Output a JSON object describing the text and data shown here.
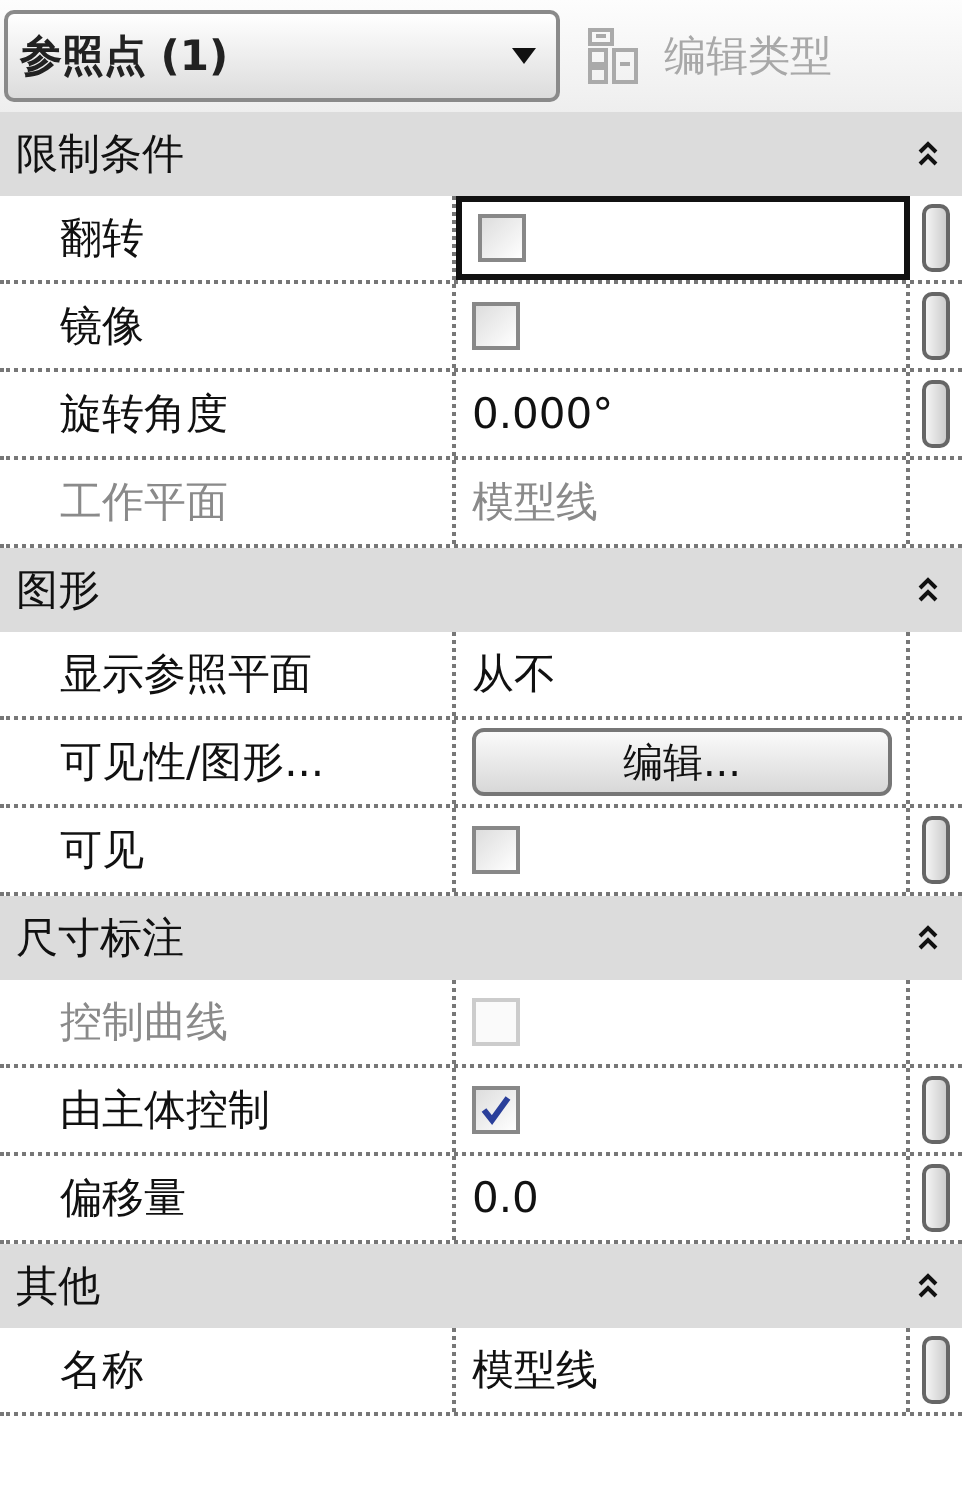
{
  "type_selector": {
    "value": "参照点 (1)"
  },
  "edit_type_button": {
    "label": "编辑类型",
    "disabled": true
  },
  "sections": [
    {
      "title": "限制条件",
      "expanded": true,
      "rows": [
        {
          "label": "翻转",
          "kind": "checkbox",
          "checked": false,
          "disabled": false,
          "focused": true,
          "associate": true
        },
        {
          "label": "镜像",
          "kind": "checkbox",
          "checked": false,
          "disabled": false,
          "focused": false,
          "associate": true
        },
        {
          "label": "旋转角度",
          "kind": "text",
          "value": "0.000°",
          "disabled": false,
          "focused": false,
          "associate": true
        },
        {
          "label": "工作平面",
          "kind": "text",
          "value": "模型线",
          "disabled": true,
          "focused": false,
          "associate": false
        }
      ]
    },
    {
      "title": "图形",
      "expanded": true,
      "rows": [
        {
          "label": "显示参照平面",
          "kind": "text",
          "value": "从不",
          "disabled": false,
          "focused": false,
          "associate": false
        },
        {
          "label": "可见性/图形...",
          "kind": "button",
          "value": "编辑...",
          "disabled": false,
          "focused": false,
          "associate": false
        },
        {
          "label": "可见",
          "kind": "checkbox",
          "checked": false,
          "disabled": false,
          "focused": false,
          "associate": true
        }
      ]
    },
    {
      "title": "尺寸标注",
      "expanded": true,
      "rows": [
        {
          "label": "控制曲线",
          "kind": "checkbox",
          "checked": false,
          "disabled": true,
          "focused": false,
          "associate": false
        },
        {
          "label": "由主体控制",
          "kind": "checkbox",
          "checked": true,
          "disabled": false,
          "focused": false,
          "associate": true
        },
        {
          "label": "偏移量",
          "kind": "text",
          "value": "0.0",
          "disabled": false,
          "focused": false,
          "associate": true
        }
      ]
    },
    {
      "title": "其他",
      "expanded": true,
      "rows": [
        {
          "label": "名称",
          "kind": "text",
          "value": "模型线",
          "disabled": false,
          "focused": false,
          "associate": true
        }
      ]
    }
  ]
}
